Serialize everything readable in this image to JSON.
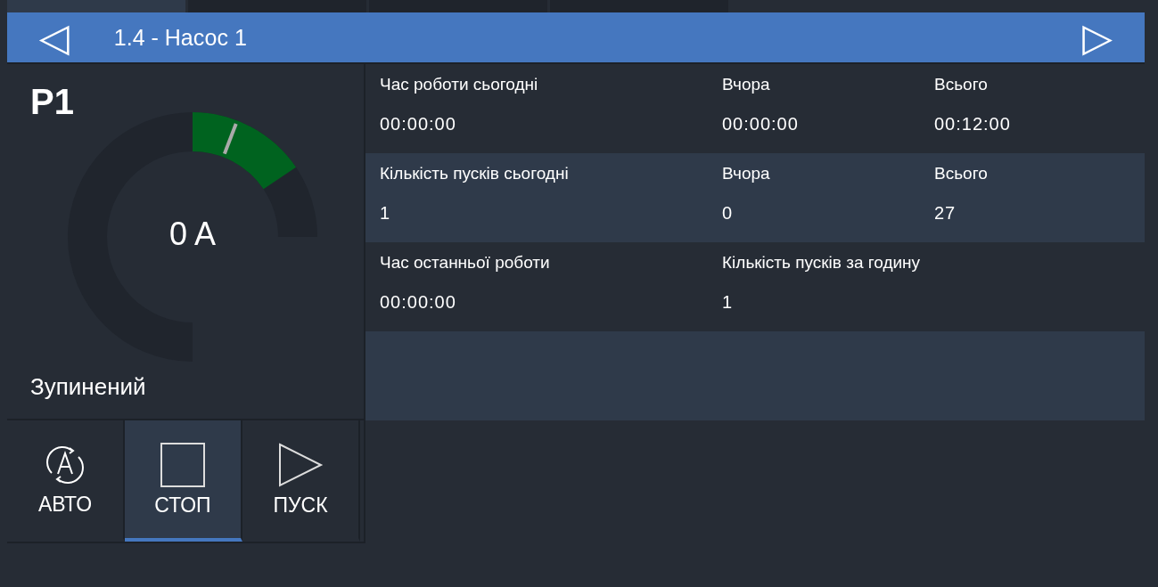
{
  "top_tabs": [
    {
      "selected": true
    },
    {
      "selected": false
    },
    {
      "selected": false
    },
    {
      "selected": false
    }
  ],
  "header": {
    "title": "1.4 - Насос 1",
    "prev": "◁",
    "next": "▷"
  },
  "pump": {
    "name": "P1",
    "reading": "0 A",
    "status": "Зупинений"
  },
  "modes": [
    {
      "kind": "auto",
      "label": "АВТО",
      "selected": false
    },
    {
      "kind": "stop",
      "label": "СТОП",
      "selected": true
    },
    {
      "kind": "start",
      "label": "ПУСК",
      "selected": false
    }
  ],
  "stats": [
    {
      "cells": [
        {
          "label": "Час роботи сьогодні",
          "value": "00:00:00"
        },
        {
          "label": "Вчора",
          "value": "00:00:00"
        },
        {
          "label": "Всього",
          "value": "00:12:00"
        }
      ]
    },
    {
      "cells": [
        {
          "label": "Кількість пусків сьогодні",
          "value": "1"
        },
        {
          "label": "Вчора",
          "value": "0"
        },
        {
          "label": "Всього",
          "value": "27"
        }
      ]
    },
    {
      "cells": [
        {
          "label": "Час останньої роботи",
          "value": "00:00:00"
        },
        {
          "label": "Кількість пусків за годину",
          "value": "1"
        }
      ]
    }
  ]
}
